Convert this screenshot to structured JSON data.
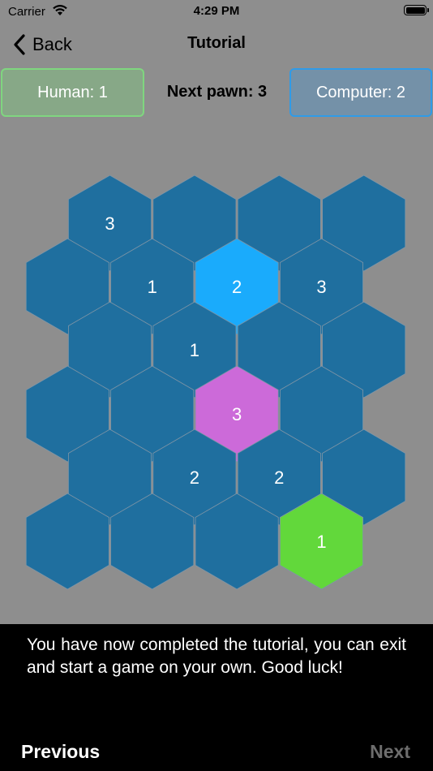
{
  "status_bar": {
    "carrier": "Carrier",
    "time": "4:29 PM"
  },
  "nav": {
    "back_label": "Back",
    "title": "Tutorial"
  },
  "scores": {
    "human": "Human: 1",
    "next_pawn": "Next pawn: 3",
    "computer": "Computer:  2"
  },
  "colors": {
    "background": "#8e8e8e",
    "empty_cell": "#1f6f9f",
    "computer_cell": "#1aabfc",
    "human_cell": "#62d83b",
    "highlight_cell": "#cc6ad9",
    "cell_border": "#7f95a6"
  },
  "board": {
    "rows": [
      [
        {
          "label": "3",
          "state": "empty"
        },
        {
          "label": "",
          "state": "empty"
        },
        {
          "label": "",
          "state": "empty"
        },
        {
          "label": "",
          "state": "empty"
        }
      ],
      [
        {
          "label": "",
          "state": "empty"
        },
        {
          "label": "1",
          "state": "empty"
        },
        {
          "label": "2",
          "state": "computer"
        },
        {
          "label": "3",
          "state": "empty"
        }
      ],
      [
        {
          "label": "",
          "state": "empty"
        },
        {
          "label": "1",
          "state": "empty"
        },
        {
          "label": "",
          "state": "empty"
        },
        {
          "label": "",
          "state": "empty"
        }
      ],
      [
        {
          "label": "",
          "state": "empty"
        },
        {
          "label": "",
          "state": "empty"
        },
        {
          "label": "3",
          "state": "highlight"
        },
        {
          "label": "",
          "state": "empty"
        }
      ],
      [
        {
          "label": "",
          "state": "empty"
        },
        {
          "label": "2",
          "state": "empty"
        },
        {
          "label": "2",
          "state": "empty"
        },
        {
          "label": "",
          "state": "empty"
        }
      ],
      [
        {
          "label": "",
          "state": "empty"
        },
        {
          "label": "",
          "state": "empty"
        },
        {
          "label": "",
          "state": "empty"
        },
        {
          "label": "1",
          "state": "human"
        }
      ]
    ]
  },
  "message": {
    "text": "You have now completed the tutorial, you can exit and start a game on your own. Good luck!",
    "previous_label": "Previous",
    "next_label": "Next"
  }
}
